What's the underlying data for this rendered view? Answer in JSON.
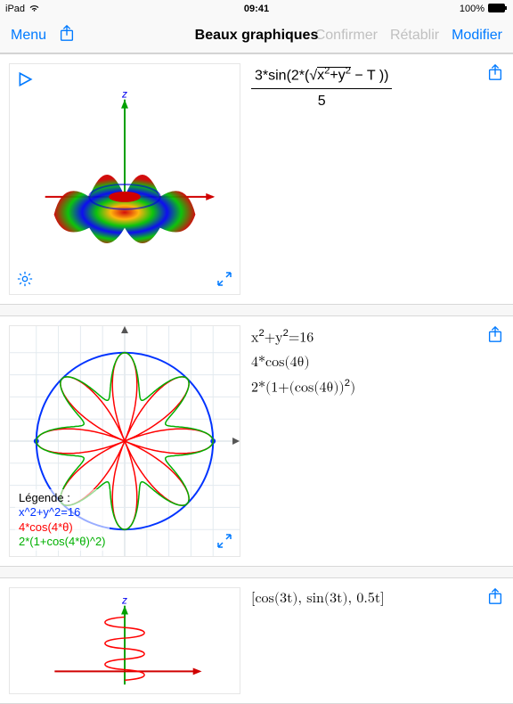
{
  "status": {
    "carrier": "iPad",
    "wifi": "wifi-icon",
    "time": "09:41",
    "battery_pct": "100%"
  },
  "nav": {
    "menu": "Menu",
    "title": "Beaux graphiques",
    "confirm": "Confirmer",
    "retablir": "Rétablir",
    "modifier": "Modifier"
  },
  "cards": [
    {
      "formula_html": "<span class='frac'><span class='num'>3*sin(2*(√<span style='border-top:1px solid #000;'>x<span class='sup'>2</span>+y<span class='sup'>2</span></span> − T ))</span><span class='den'>5</span></span>",
      "axis_label": "z"
    },
    {
      "formulas": [
        "x^2+y^2=16",
        "4*cos(4θ)",
        "2*(1+(cos(4θ))^2)"
      ],
      "legend_title": "Légende :",
      "legend": [
        {
          "text": "x^2+y^2=16",
          "color": "#0033ff"
        },
        {
          "text": "4*cos(4*θ)",
          "color": "#ff0000"
        },
        {
          "text": "2*(1+cos(4*θ)^2)",
          "color": "#00b000"
        }
      ],
      "formula_html": "x<span class='sup'>2</span>+y<span class='sup'>2</span>=16<br>4*cos(4θ)<br>2*(1+(cos(4θ))<span class='sup'>2</span>)"
    },
    {
      "formula_html": "[cos(3t), sin(3t), 0.5t]",
      "axis_label": "z"
    }
  ],
  "chart_data": [
    {
      "type": "surface3d",
      "function": "z = 3*sin(2*(sqrt(x^2+y^2)-T))/5",
      "x_range": [
        -3,
        3
      ],
      "y_range": [
        -3,
        3
      ],
      "z_range": [
        -0.6,
        0.6
      ],
      "colormap": "hsv",
      "axis_label_z": "z"
    },
    {
      "type": "polar-multi",
      "x_range": [
        -5,
        5
      ],
      "y_range": [
        -5,
        5
      ],
      "grid": true,
      "series": [
        {
          "name": "x^2+y^2=16",
          "kind": "cartesian",
          "equation": "x^2+y^2=16",
          "color": "#0033ff"
        },
        {
          "name": "4*cos(4θ)",
          "kind": "polar",
          "equation": "r=4*cos(4*θ)",
          "color": "#ff0000"
        },
        {
          "name": "2*(1+cos(4θ)^2)",
          "kind": "polar",
          "equation": "r=2*(1+cos(4*θ)^2)",
          "color": "#00b000"
        }
      ],
      "legend_title": "Légende :",
      "legend_position": "bottom-left"
    },
    {
      "type": "parametric3d",
      "equation": "[cos(3t), sin(3t), 0.5t]",
      "t_range": [
        -6,
        6
      ],
      "color": "#ff0000",
      "axis_label_z": "z"
    }
  ]
}
